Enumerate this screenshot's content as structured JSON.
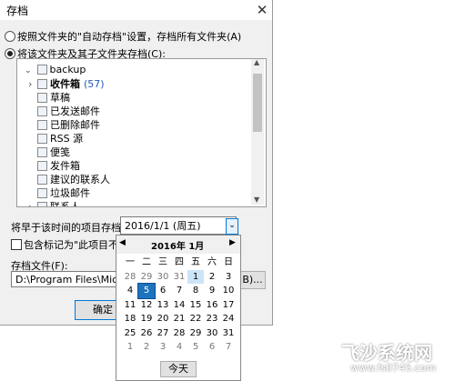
{
  "window": {
    "title": "存档",
    "close_glyph": "✕"
  },
  "options": {
    "radio1": "按照文件夹的\"自动存档\"设置，存档所有文件夹(A)",
    "radio2": "将该文件夹及其子文件夹存档(C):"
  },
  "tree": {
    "root": "backup",
    "items": [
      {
        "label": "收件箱",
        "count": "(57)",
        "bold": true
      },
      {
        "label": "草稿"
      },
      {
        "label": "已发送邮件"
      },
      {
        "label": "已删除邮件"
      },
      {
        "label": "RSS 源"
      },
      {
        "label": "便笺"
      },
      {
        "label": "发件箱"
      },
      {
        "label": "建议的联系人"
      },
      {
        "label": "垃圾邮件"
      },
      {
        "label": "联系人"
      }
    ]
  },
  "archive_date": {
    "label": "将早于该时间的项目存档(O):",
    "value": "2016/1/1 (周五)"
  },
  "include_checkbox": {
    "label": "包含标记为\"此项目不自动存"
  },
  "archive_file": {
    "label": "存档文件(F):",
    "path": "D:\\Program Files\\Microsof",
    "browse": "B)..."
  },
  "ok_button": "确定",
  "calendar": {
    "month": "2016年 1月",
    "prev": "◀",
    "next": "▶",
    "weekdays": [
      "一",
      "二",
      "三",
      "四",
      "五",
      "六",
      "日"
    ],
    "weeks": [
      [
        "28",
        "29",
        "30",
        "31",
        "1",
        "2",
        "3"
      ],
      [
        "4",
        "5",
        "6",
        "7",
        "8",
        "9",
        "10"
      ],
      [
        "11",
        "12",
        "13",
        "14",
        "15",
        "16",
        "17"
      ],
      [
        "18",
        "19",
        "20",
        "21",
        "22",
        "23",
        "24"
      ],
      [
        "25",
        "26",
        "27",
        "28",
        "29",
        "30",
        "31"
      ],
      [
        "1",
        "2",
        "3",
        "4",
        "5",
        "6",
        "7"
      ]
    ],
    "selected": "5",
    "today_label": "今天"
  },
  "watermark": {
    "text": "飞沙系统网",
    "url": "www.fs0745.com"
  }
}
